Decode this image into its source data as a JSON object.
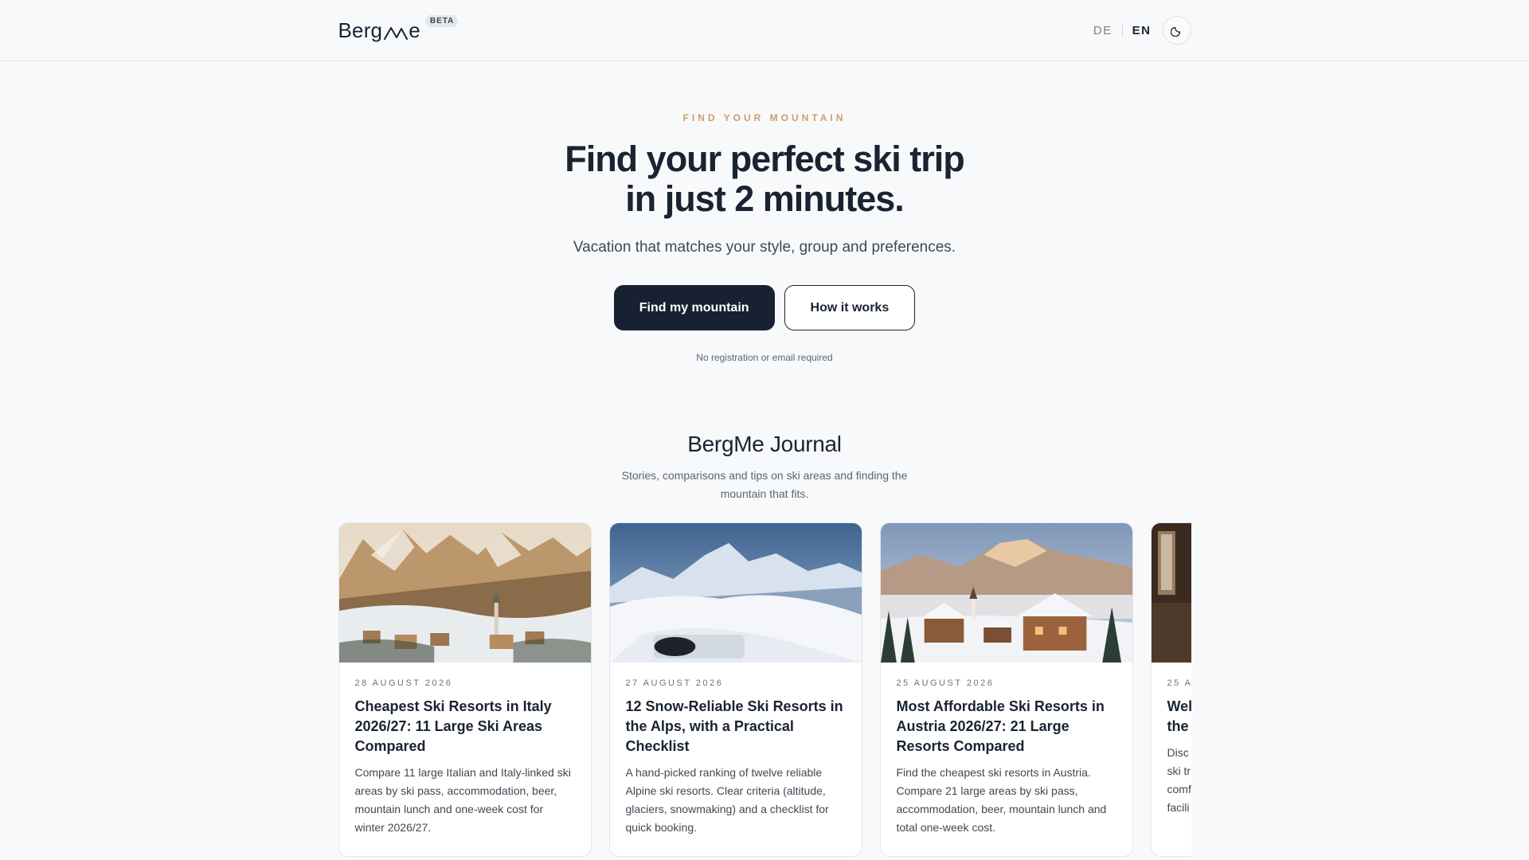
{
  "header": {
    "logo_text_left": "Berg",
    "logo_text_right": "e",
    "logo_icon": "mountain-m-icon",
    "beta_badge": "BETA",
    "languages": [
      {
        "code": "DE",
        "active": false
      },
      {
        "code": "EN",
        "active": true
      }
    ],
    "theme_toggle_icon": "moon-icon"
  },
  "hero": {
    "eyebrow": "FIND YOUR MOUNTAIN",
    "title": "Find your perfect ski trip in just 2 minutes.",
    "subtitle": "Vacation that matches your style, group and preferences.",
    "primary_button": "Find my mountain",
    "secondary_button": "How it works",
    "note": "No registration or email required"
  },
  "journal": {
    "title": "BergMe Journal",
    "subtitle": "Stories, comparisons and tips on ski areas and finding the mountain that fits.",
    "cards": [
      {
        "date": "28 AUGUST 2026",
        "title": "Cheapest Ski Resorts in Italy 2026/27: 11 Large Ski Areas Compared",
        "excerpt": "Compare 11 large Italian and Italy-linked ski areas by ski pass, accommodation, beer, mountain lunch and one-week cost for winter 2026/27."
      },
      {
        "date": "27 AUGUST 2026",
        "title": "12 Snow-Reliable Ski Resorts in the Alps, with a Practical Checklist",
        "excerpt": "A hand-picked ranking of twelve reliable Alpine ski resorts. Clear criteria (altitude, glaciers, snowmaking) and a checklist for quick booking."
      },
      {
        "date": "25 AUGUST 2026",
        "title": "Most Affordable Ski Resorts in Austria 2026/27: 21 Large Resorts Compared",
        "excerpt": "Find the cheapest ski resorts in Austria. Compare 21 large areas by ski pass, accommodation, beer, mountain lunch and total one-week cost."
      },
      {
        "date": "25 A",
        "title": "Wel\nthe",
        "excerpt": "Disc\nski tr\ncomf\nfacili"
      }
    ]
  },
  "colors": {
    "accent_gold": "#c9a06a",
    "navy": "#172132",
    "background": "#f8f9fa"
  }
}
